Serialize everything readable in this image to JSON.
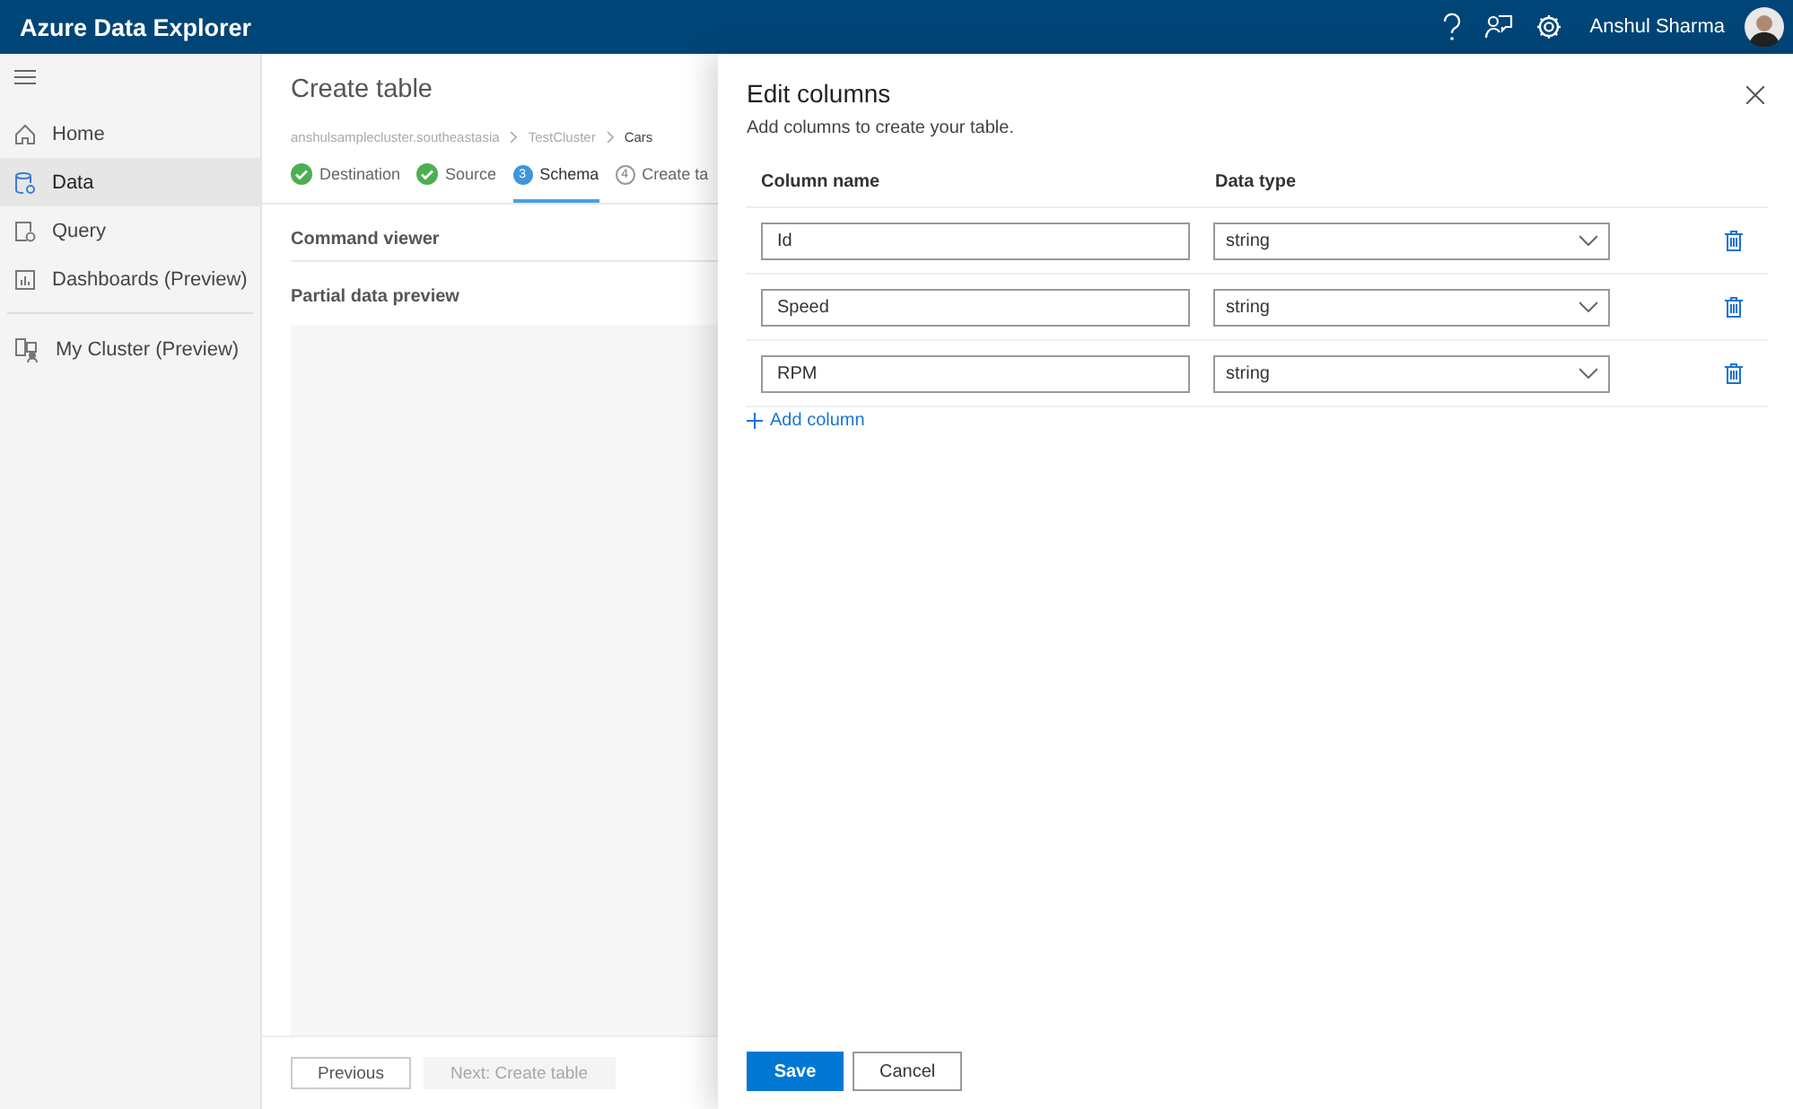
{
  "header": {
    "title": "Azure Data Explorer",
    "user": "Anshul Sharma"
  },
  "sidebar": {
    "items": [
      {
        "label": "Home",
        "selected": false
      },
      {
        "label": "Data",
        "selected": true
      },
      {
        "label": "Query",
        "selected": false
      },
      {
        "label": "Dashboards (Preview)",
        "selected": false
      }
    ],
    "bottom_items": [
      {
        "label": "My Cluster (Preview)",
        "selected": false
      }
    ]
  },
  "wizard": {
    "title": "Create table",
    "breadcrumb": [
      "anshulsamplecluster.southeastasia",
      "TestCluster",
      "Cars"
    ],
    "steps": [
      {
        "label": "Destination",
        "kind": "done",
        "selected": false
      },
      {
        "label": "Source",
        "kind": "done",
        "selected": false
      },
      {
        "label": "Schema",
        "kind": "current",
        "number": "3",
        "selected": true
      },
      {
        "label": "Create ta",
        "kind": "pending",
        "number": "4",
        "selected": false
      }
    ],
    "sections": [
      "Command viewer",
      "Partial data preview"
    ],
    "buttons": [
      {
        "label": "Previous",
        "disabled": false
      },
      {
        "label": "Next: Create table",
        "disabled": true
      }
    ]
  },
  "panel": {
    "title": "Edit columns",
    "subtitle": "Add columns to create your table.",
    "columns": [
      "Column name",
      "Data type"
    ],
    "rows": [
      {
        "name": "Id",
        "type": "string"
      },
      {
        "name": "Speed",
        "type": "string"
      },
      {
        "name": "RPM",
        "type": "string"
      }
    ],
    "add_label": "Add column",
    "buttons": [
      {
        "label": "Save",
        "kind": "primary"
      },
      {
        "label": "Cancel",
        "kind": "default"
      }
    ]
  }
}
